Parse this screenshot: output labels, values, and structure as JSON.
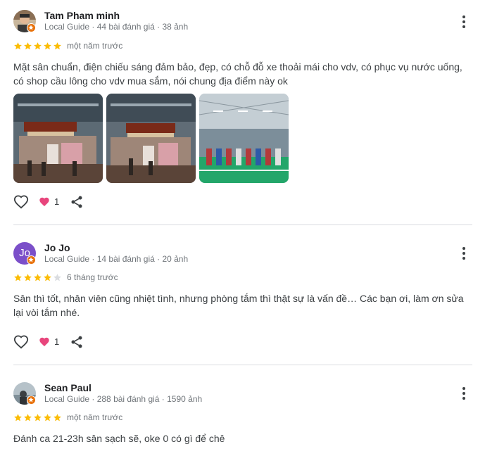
{
  "reviews": [
    {
      "name": "Tam Pham minh",
      "meta": "Local Guide · 44 bài đánh giá · 38 ảnh",
      "rating": 5,
      "when": "một năm trước",
      "text": "Mặt sân chuẩn, điện chiếu sáng đảm bảo, đẹp, có chỗ đỗ xe thoải mái cho vdv, có phục vụ nước uống, có shop cầu lông cho vdv mua sắm, nói chung địa điểm này ok",
      "likes": "1"
    },
    {
      "name": "Jo Jo",
      "avatar_letters": "Jo",
      "meta": "Local Guide · 14 bài đánh giá · 20 ảnh",
      "rating": 4,
      "when": "6 tháng trước",
      "text": "Sân thì tốt, nhân viên cũng nhiệt tình, nhưng phòng tắm thì thật sự là vấn đề… Các bạn ơi, làm ơn sửa lại vòi tắm nhé.",
      "likes": "1"
    },
    {
      "name": "Sean Paul",
      "meta": "Local Guide · 288 bài đánh giá · 1590 ảnh",
      "rating": 5,
      "when": "một năm trước",
      "text": "Đánh ca 21-23h sân sạch sẽ, oke 0 có gì để chê"
    }
  ],
  "colors": {
    "star": "#fbbc04",
    "star_empty": "#dadce0",
    "heart": "#e8457c",
    "local_guide_badge": "#e8710a",
    "avatar_jo": "#7b4fc9"
  },
  "icons": [
    "more-vert-icon",
    "like-icon",
    "heart-icon",
    "share-icon",
    "star-icon"
  ]
}
